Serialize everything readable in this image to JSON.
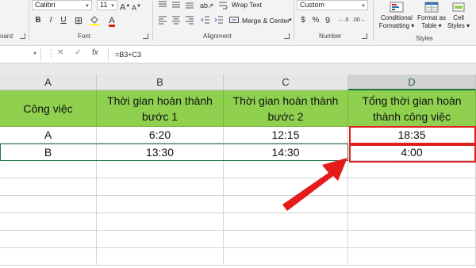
{
  "ribbon": {
    "clipboard_label": "oard",
    "font": {
      "name": "Calibri",
      "size": "11",
      "group_label": "Font"
    },
    "alignment": {
      "wrap_text": "Wrap Text",
      "merge_center": "Merge & Center",
      "group_label": "Alignment"
    },
    "number": {
      "format": "Custom",
      "group_label": "Number",
      "dollar": "$",
      "percent": "%",
      "comma": "9"
    },
    "styles": {
      "conditional": [
        "Conditional",
        "Formatting"
      ],
      "format_table": [
        "Format as",
        "Table"
      ],
      "cell_styles": [
        "Cell",
        "Styles"
      ],
      "group_label": "Styles"
    }
  },
  "formula_bar": {
    "fx": "fx",
    "formula": "=B3+C3"
  },
  "columns": [
    "A",
    "B",
    "C",
    "D"
  ],
  "selected_column": "D",
  "table": {
    "header": [
      "Công việc",
      "Thời gian hoàn thành bước 1",
      "Thời gian hoàn thành bước 2",
      "Tổng thời gian hoàn thành công việc"
    ],
    "rows": [
      [
        "A",
        "6:20",
        "12:15",
        "18:35"
      ],
      [
        "B",
        "13:30",
        "14:30",
        "4:00"
      ]
    ]
  },
  "colors": {
    "header_fill": "#8fd14f",
    "highlight": "#e02020",
    "excel_green": "#217346"
  }
}
